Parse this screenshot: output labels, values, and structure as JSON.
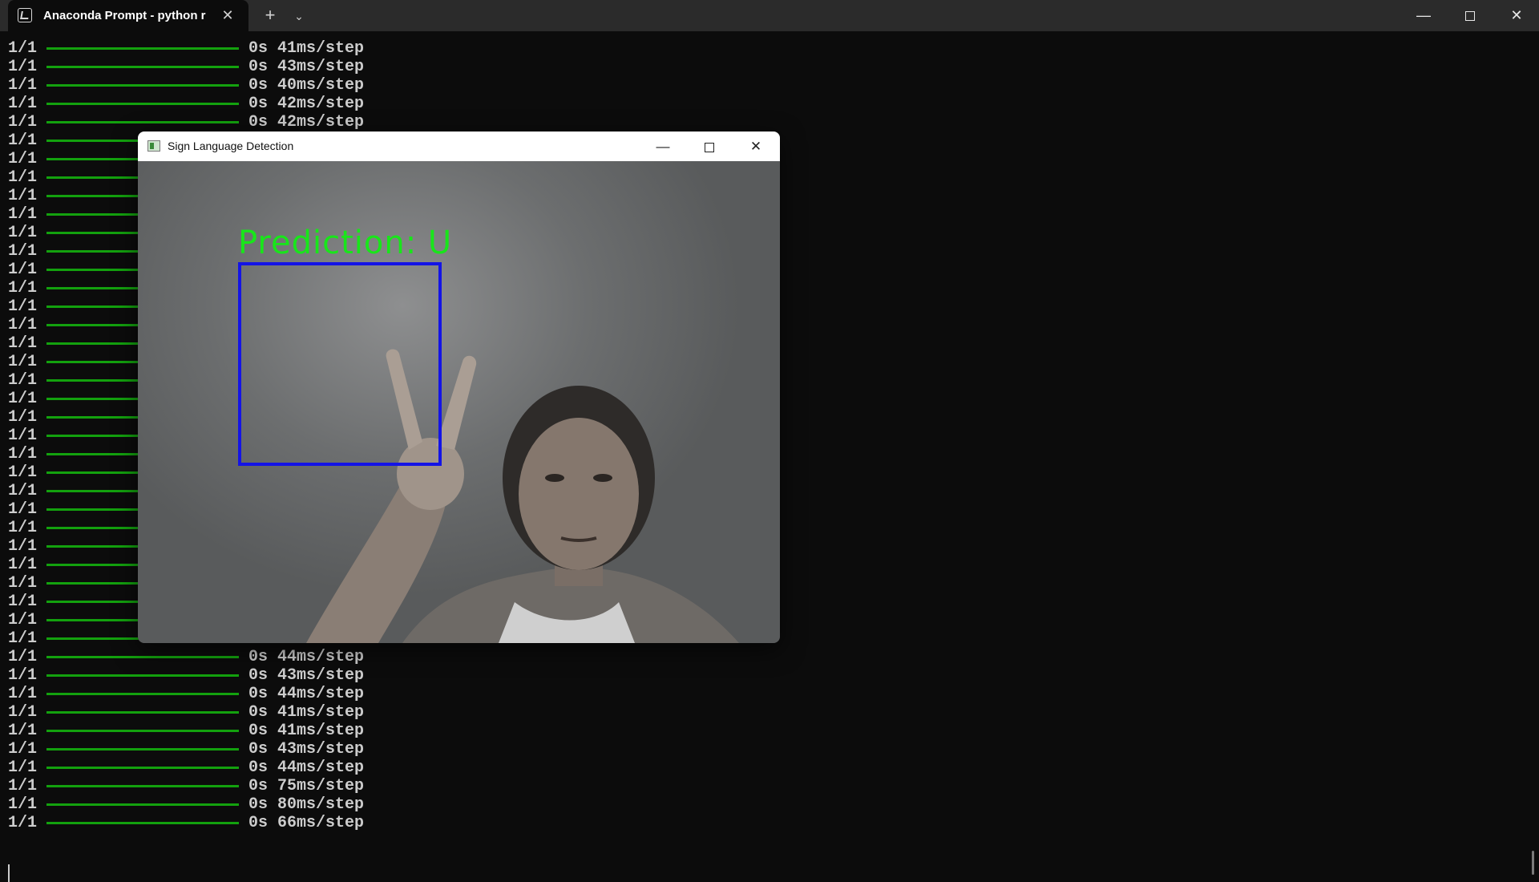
{
  "terminal": {
    "tab_title": "Anaconda Prompt - python  r",
    "tab_close_icon": "close-icon",
    "new_tab_icon": "plus-icon",
    "dropdown_icon": "chevron-down-icon",
    "window_controls": [
      "minimize-icon",
      "restore-icon",
      "close-icon"
    ],
    "progress_color": "#13a10e",
    "lines": [
      {
        "frac": "1/1",
        "time": "0s 41ms/step"
      },
      {
        "frac": "1/1",
        "time": "0s 43ms/step"
      },
      {
        "frac": "1/1",
        "time": "0s 40ms/step"
      },
      {
        "frac": "1/1",
        "time": "0s 42ms/step"
      },
      {
        "frac": "1/1",
        "time": "0s 42ms/step"
      },
      {
        "frac": "1/1",
        "time": ""
      },
      {
        "frac": "1/1",
        "time": ""
      },
      {
        "frac": "1/1",
        "time": ""
      },
      {
        "frac": "1/1",
        "time": ""
      },
      {
        "frac": "1/1",
        "time": ""
      },
      {
        "frac": "1/1",
        "time": ""
      },
      {
        "frac": "1/1",
        "time": ""
      },
      {
        "frac": "1/1",
        "time": ""
      },
      {
        "frac": "1/1",
        "time": ""
      },
      {
        "frac": "1/1",
        "time": ""
      },
      {
        "frac": "1/1",
        "time": ""
      },
      {
        "frac": "1/1",
        "time": ""
      },
      {
        "frac": "1/1",
        "time": ""
      },
      {
        "frac": "1/1",
        "time": ""
      },
      {
        "frac": "1/1",
        "time": ""
      },
      {
        "frac": "1/1",
        "time": ""
      },
      {
        "frac": "1/1",
        "time": ""
      },
      {
        "frac": "1/1",
        "time": ""
      },
      {
        "frac": "1/1",
        "time": ""
      },
      {
        "frac": "1/1",
        "time": ""
      },
      {
        "frac": "1/1",
        "time": ""
      },
      {
        "frac": "1/1",
        "time": ""
      },
      {
        "frac": "1/1",
        "time": ""
      },
      {
        "frac": "1/1",
        "time": ""
      },
      {
        "frac": "1/1",
        "time": ""
      },
      {
        "frac": "1/1",
        "time": ""
      },
      {
        "frac": "1/1",
        "time": ""
      },
      {
        "frac": "1/1",
        "time": ""
      },
      {
        "frac": "1/1",
        "time": "0s 44ms/step"
      },
      {
        "frac": "1/1",
        "time": "0s 43ms/step"
      },
      {
        "frac": "1/1",
        "time": "0s 44ms/step"
      },
      {
        "frac": "1/1",
        "time": "0s 41ms/step"
      },
      {
        "frac": "1/1",
        "time": "0s 41ms/step"
      },
      {
        "frac": "1/1",
        "time": "0s 43ms/step"
      },
      {
        "frac": "1/1",
        "time": "0s 44ms/step"
      },
      {
        "frac": "1/1",
        "time": "0s 75ms/step"
      },
      {
        "frac": "1/1",
        "time": "0s 80ms/step"
      },
      {
        "frac": "1/1",
        "time": "0s 66ms/step"
      }
    ]
  },
  "cv_window": {
    "title": "Sign Language Detection",
    "app_icon": "opencv-window-icon",
    "window_controls": [
      "minimize-icon",
      "maximize-icon",
      "close-icon"
    ],
    "prediction_text": "Prediction: U",
    "prediction_color": "#18e61a",
    "roi_box_color": "#1414e6"
  }
}
